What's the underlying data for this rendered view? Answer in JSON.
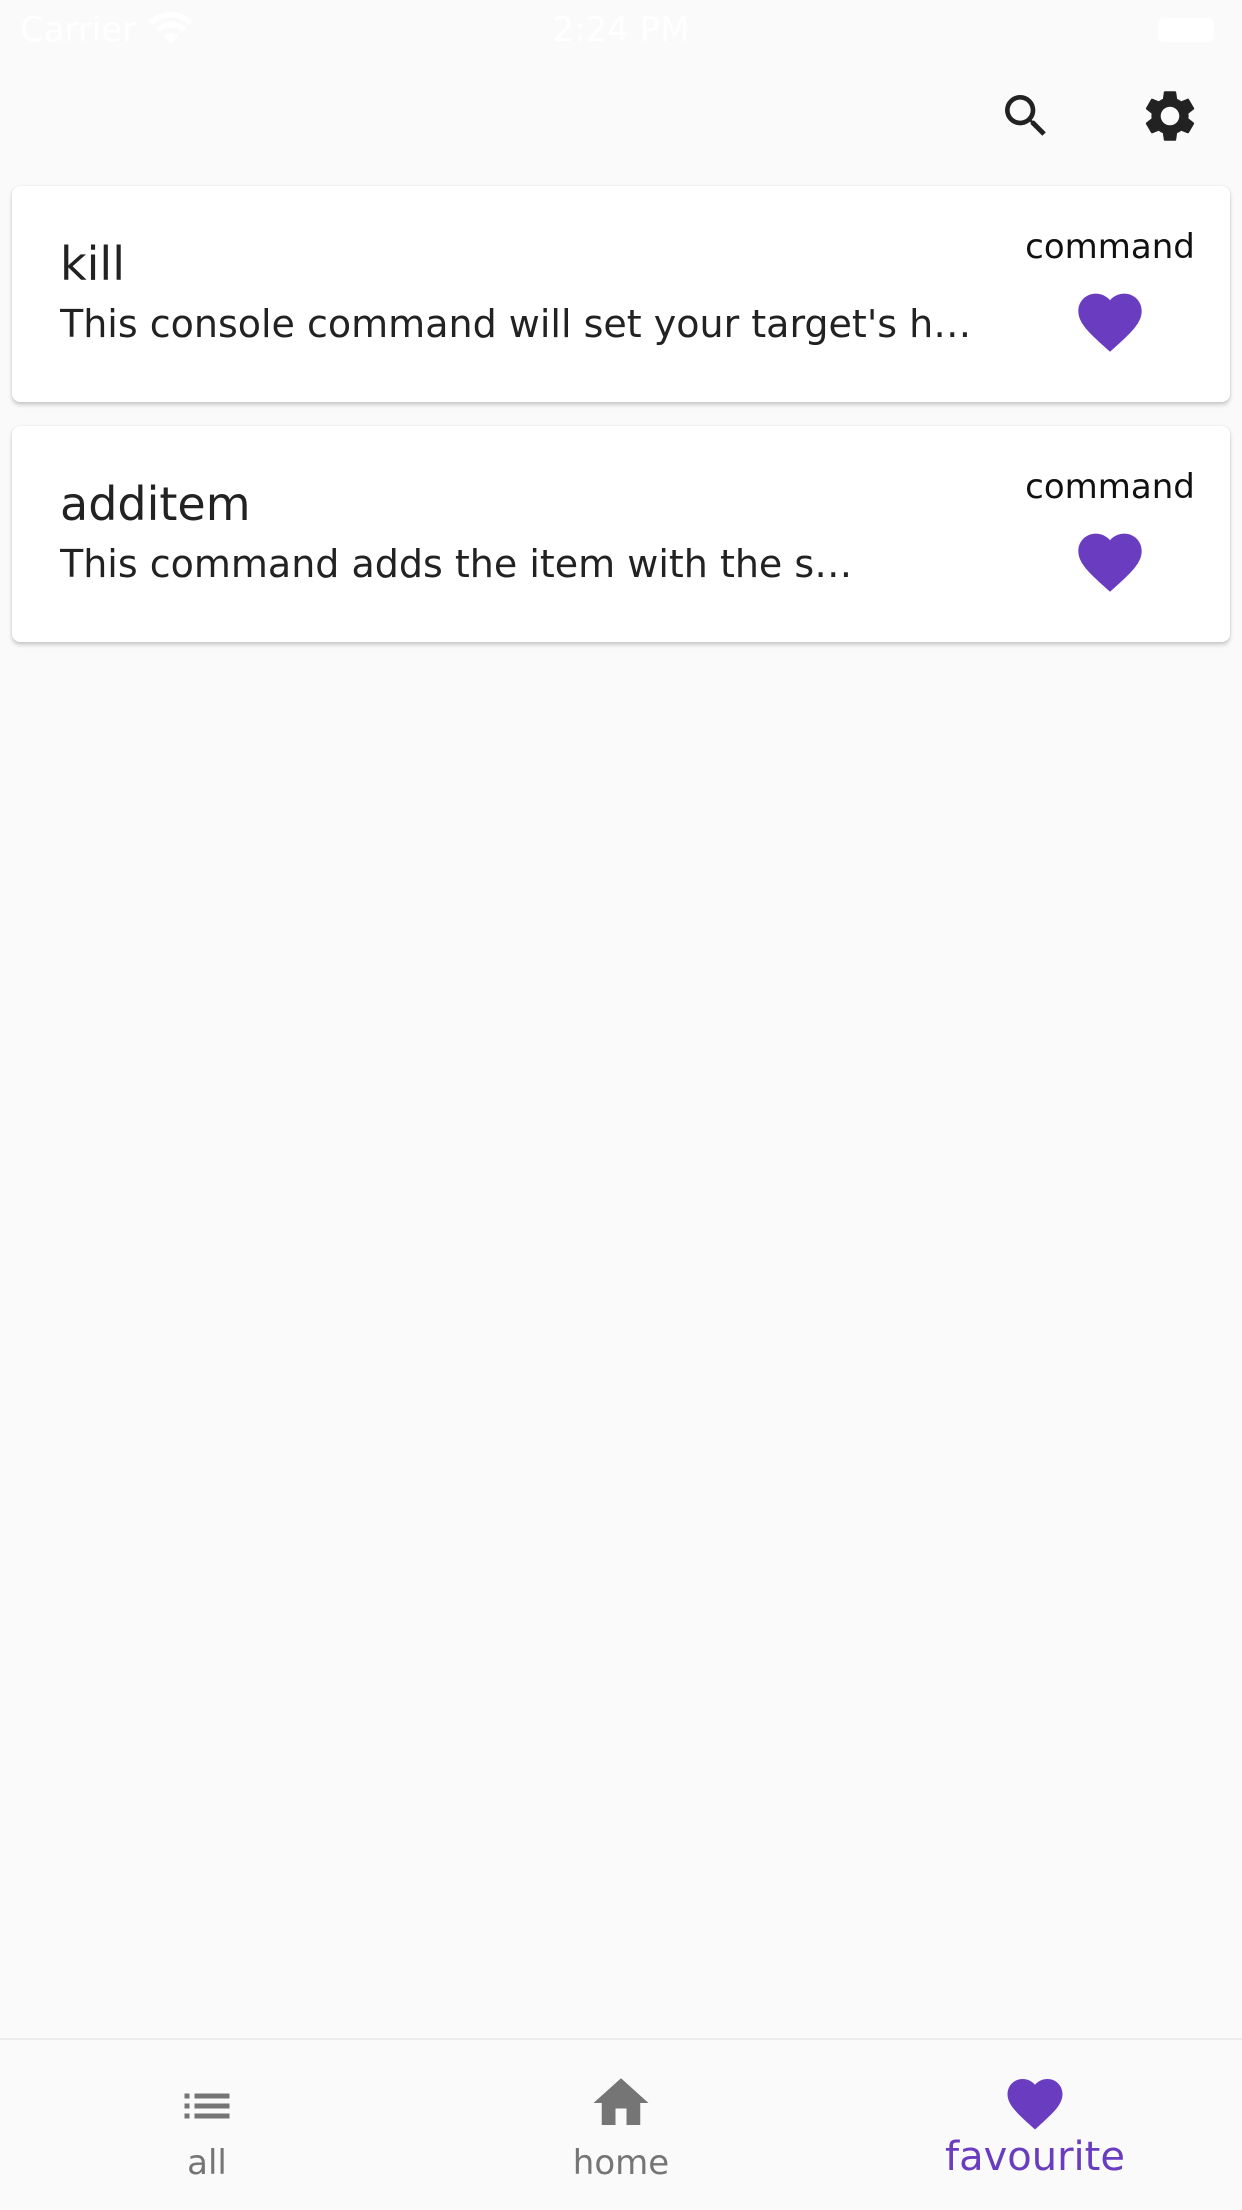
{
  "status_bar": {
    "carrier": "Carrier",
    "time": "2:24 PM"
  },
  "toolbar": {
    "search_icon": "search-icon",
    "settings_icon": "gear-icon"
  },
  "items": [
    {
      "title": "kill",
      "description": "This console command will set your target's health to zero, killing them instantly.",
      "type": "command",
      "favourite": true
    },
    {
      "title": "additem",
      "description": "This command adds the item with the specified ID to the target's inventory.",
      "type": "command",
      "favourite": true
    }
  ],
  "bottom_nav": {
    "items": [
      {
        "label": "all",
        "icon": "list-icon",
        "active": false
      },
      {
        "label": "home",
        "icon": "home-icon",
        "active": false
      },
      {
        "label": "favourite",
        "icon": "heart-icon",
        "active": true
      }
    ]
  },
  "colors": {
    "accent": "#6a3cc0",
    "inactive": "#757575",
    "background": "#fafafa"
  }
}
